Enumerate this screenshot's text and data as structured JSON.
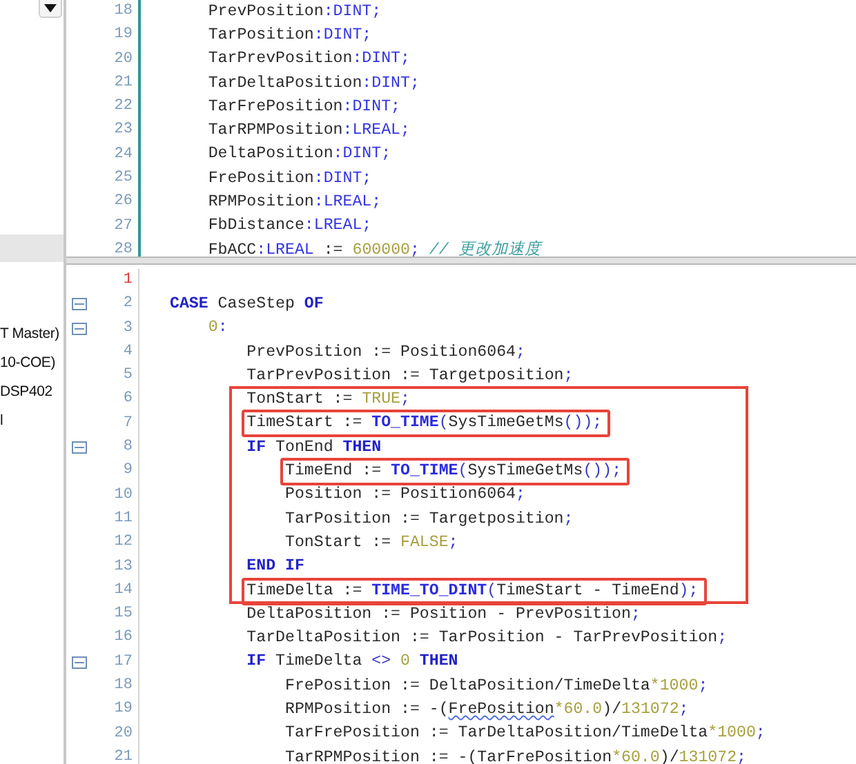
{
  "sidebar": {
    "items": [
      {
        "selected": true
      },
      {
        "label": "T Master)",
        "selected": false
      },
      {
        "label": "10-COE)",
        "selected": false
      },
      {
        "label": "DSP402",
        "selected": false
      },
      {
        "label": "l",
        "selected": false
      }
    ]
  },
  "declarations": {
    "lines": [
      {
        "number": "18",
        "tokens": [
          {
            "kind": "name",
            "text": "    PrevPosition"
          },
          {
            "kind": "type",
            "text": ":DINT;"
          }
        ]
      },
      {
        "number": "19",
        "tokens": [
          {
            "kind": "name",
            "text": "    TarPosition"
          },
          {
            "kind": "type",
            "text": ":DINT;"
          }
        ]
      },
      {
        "number": "20",
        "tokens": [
          {
            "kind": "name",
            "text": "    TarPrevPosition"
          },
          {
            "kind": "type",
            "text": ":DINT;"
          }
        ]
      },
      {
        "number": "21",
        "tokens": [
          {
            "kind": "name",
            "text": "    TarDeltaPosition"
          },
          {
            "kind": "type",
            "text": ":DINT;"
          }
        ]
      },
      {
        "number": "22",
        "tokens": [
          {
            "kind": "name",
            "text": "    TarFrePosition"
          },
          {
            "kind": "type",
            "text": ":DINT;"
          }
        ]
      },
      {
        "number": "23",
        "tokens": [
          {
            "kind": "name",
            "text": "    TarRPMPosition"
          },
          {
            "kind": "type",
            "text": ":LREAL;"
          }
        ]
      },
      {
        "number": "24",
        "tokens": [
          {
            "kind": "name",
            "text": "    DeltaPosition"
          },
          {
            "kind": "type",
            "text": ":DINT;"
          }
        ]
      },
      {
        "number": "25",
        "tokens": [
          {
            "kind": "name",
            "text": "    FrePosition"
          },
          {
            "kind": "type",
            "text": ":DINT;"
          }
        ]
      },
      {
        "number": "26",
        "tokens": [
          {
            "kind": "name",
            "text": "    RPMPosition"
          },
          {
            "kind": "type",
            "text": ":LREAL;"
          }
        ]
      },
      {
        "number": "27",
        "tokens": [
          {
            "kind": "name",
            "text": "    FbDistance"
          },
          {
            "kind": "type",
            "text": ":LREAL;"
          }
        ]
      },
      {
        "number": "28",
        "tokens": [
          {
            "kind": "name",
            "text": "    FbACC"
          },
          {
            "kind": "type",
            "text": ":LREAL"
          },
          {
            "kind": "name",
            "text": " := "
          },
          {
            "kind": "literal",
            "text": "600000"
          },
          {
            "kind": "punct",
            "text": ";"
          },
          {
            "kind": "comment",
            "text": " // 更改加速度"
          }
        ]
      }
    ]
  },
  "implementation": {
    "lines": [
      {
        "kind": "line",
        "number": "1",
        "current": true,
        "foldable": false
      },
      {
        "kind": "line",
        "number": "2",
        "current": false,
        "foldable": true,
        "tokens": [
          {
            "kind": "keyword",
            "text": "CASE"
          },
          {
            "kind": "name",
            "text": " CaseStep "
          },
          {
            "kind": "keyword",
            "text": "OF"
          }
        ]
      },
      {
        "kind": "line",
        "number": "3",
        "current": false,
        "foldable": true,
        "tokens": [
          {
            "kind": "literal",
            "text": "    0"
          },
          {
            "kind": "punct",
            "text": ":"
          }
        ]
      },
      {
        "kind": "line",
        "number": "4",
        "current": false,
        "foldable": false,
        "tokens": [
          {
            "kind": "name",
            "text": "        PrevPosition := Position6064"
          },
          {
            "kind": "punct",
            "text": ";"
          }
        ]
      },
      {
        "kind": "line",
        "number": "5",
        "current": false,
        "foldable": false,
        "tokens": [
          {
            "kind": "name",
            "text": "        TarPrevPosition := Targetposition"
          },
          {
            "kind": "punct",
            "text": ";"
          }
        ]
      },
      {
        "kind": "highlight",
        "lines": [
          {
            "kind": "line",
            "number": "6",
            "current": false,
            "foldable": false,
            "tokens": [
              {
                "kind": "name",
                "text": "        TonStart := "
              },
              {
                "kind": "literal",
                "text": "TRUE"
              },
              {
                "kind": "punct",
                "text": ";"
              }
            ]
          },
          {
            "kind": "highlight",
            "lines": [
              {
                "kind": "line",
                "number": "7",
                "current": false,
                "foldable": false,
                "tokens": [
                  {
                    "kind": "name",
                    "text": "        TimeStart := "
                  },
                  {
                    "kind": "function",
                    "text": "TO_TIME"
                  },
                  {
                    "kind": "punct",
                    "text": "("
                  },
                  {
                    "kind": "name",
                    "text": "SysTimeGetMs"
                  },
                  {
                    "kind": "punct",
                    "text": "());"
                  }
                ]
              }
            ]
          },
          {
            "kind": "line",
            "number": "8",
            "current": false,
            "foldable": true,
            "tokens": [
              {
                "kind": "keyword",
                "text": "        IF"
              },
              {
                "kind": "name",
                "text": " TonEnd "
              },
              {
                "kind": "keyword",
                "text": "THEN"
              }
            ]
          },
          {
            "kind": "highlight",
            "lines": [
              {
                "kind": "line",
                "number": "9",
                "current": false,
                "foldable": false,
                "tokens": [
                  {
                    "kind": "name",
                    "text": "            TimeEnd := "
                  },
                  {
                    "kind": "function",
                    "text": "TO_TIME"
                  },
                  {
                    "kind": "punct",
                    "text": "("
                  },
                  {
                    "kind": "name",
                    "text": "SysTimeGetMs"
                  },
                  {
                    "kind": "punct",
                    "text": "());"
                  }
                ]
              }
            ]
          },
          {
            "kind": "line",
            "number": "10",
            "current": false,
            "foldable": false,
            "tokens": [
              {
                "kind": "name",
                "text": "            Position := Position6064"
              },
              {
                "kind": "punct",
                "text": ";"
              }
            ]
          },
          {
            "kind": "line",
            "number": "11",
            "current": false,
            "foldable": false,
            "tokens": [
              {
                "kind": "name",
                "text": "            TarPosition := Targetposition"
              },
              {
                "kind": "punct",
                "text": ";"
              }
            ]
          },
          {
            "kind": "line",
            "number": "12",
            "current": false,
            "foldable": false,
            "tokens": [
              {
                "kind": "name",
                "text": "            TonStart := "
              },
              {
                "kind": "literal",
                "text": "FALSE"
              },
              {
                "kind": "punct",
                "text": ";"
              }
            ]
          },
          {
            "kind": "line",
            "number": "13",
            "current": false,
            "foldable": false,
            "tokens": [
              {
                "kind": "keyword",
                "text": "        END IF"
              }
            ]
          },
          {
            "kind": "highlight",
            "lines": [
              {
                "kind": "line",
                "number": "14",
                "current": false,
                "foldable": false,
                "tokens": [
                  {
                    "kind": "name",
                    "text": "        TimeDelta := "
                  },
                  {
                    "kind": "function",
                    "text": "TIME_TO_DINT"
                  },
                  {
                    "kind": "punct",
                    "text": "("
                  },
                  {
                    "kind": "name",
                    "text": "TimeStart - TimeEnd"
                  },
                  {
                    "kind": "punct",
                    "text": ");"
                  }
                ]
              }
            ]
          }
        ]
      },
      {
        "kind": "line",
        "number": "15",
        "current": false,
        "foldable": false,
        "tokens": [
          {
            "kind": "name",
            "text": "        DeltaPosition := Position - PrevPosition"
          },
          {
            "kind": "punct",
            "text": ";"
          }
        ]
      },
      {
        "kind": "line",
        "number": "16",
        "current": false,
        "foldable": false,
        "tokens": [
          {
            "kind": "name",
            "text": "        TarDeltaPosition := TarPosition - TarPrevPosition"
          },
          {
            "kind": "punct",
            "text": ";"
          }
        ]
      },
      {
        "kind": "line",
        "number": "17",
        "current": false,
        "foldable": true,
        "tokens": [
          {
            "kind": "keyword",
            "text": "        IF"
          },
          {
            "kind": "name",
            "text": " TimeDelta "
          },
          {
            "kind": "punct",
            "text": "<>"
          },
          {
            "kind": "literal",
            "text": " 0 "
          },
          {
            "kind": "keyword",
            "text": "THEN"
          }
        ]
      },
      {
        "kind": "line",
        "number": "18",
        "current": false,
        "foldable": false,
        "tokens": [
          {
            "kind": "name",
            "text": "            FrePosition := DeltaPosition/TimeDelta"
          },
          {
            "kind": "literal",
            "text": "*1000"
          },
          {
            "kind": "punct",
            "text": ";"
          }
        ]
      },
      {
        "kind": "line",
        "number": "19",
        "current": false,
        "foldable": false,
        "tokens": [
          {
            "kind": "name",
            "text": "            RPMPosition := -("
          },
          {
            "kind": "flagged",
            "text": "FrePosition"
          },
          {
            "kind": "literal",
            "text": "*60.0"
          },
          {
            "kind": "name",
            "text": ")/"
          },
          {
            "kind": "literal",
            "text": "131072"
          },
          {
            "kind": "punct",
            "text": ";"
          }
        ]
      },
      {
        "kind": "line",
        "number": "20",
        "current": false,
        "foldable": false,
        "tokens": [
          {
            "kind": "name",
            "text": "            TarFrePosition := TarDeltaPosition/TimeDelta"
          },
          {
            "kind": "literal",
            "text": "*1000"
          },
          {
            "kind": "punct",
            "text": ";"
          }
        ]
      },
      {
        "kind": "line",
        "number": "21",
        "current": false,
        "foldable": false,
        "tokens": [
          {
            "kind": "name",
            "text": "            TarRPMPosition := -(TarFrePosition"
          },
          {
            "kind": "literal",
            "text": "*60.0"
          },
          {
            "kind": "name",
            "text": ")/"
          },
          {
            "kind": "literal",
            "text": "131072"
          },
          {
            "kind": "punct",
            "text": ";"
          }
        ]
      }
    ]
  }
}
